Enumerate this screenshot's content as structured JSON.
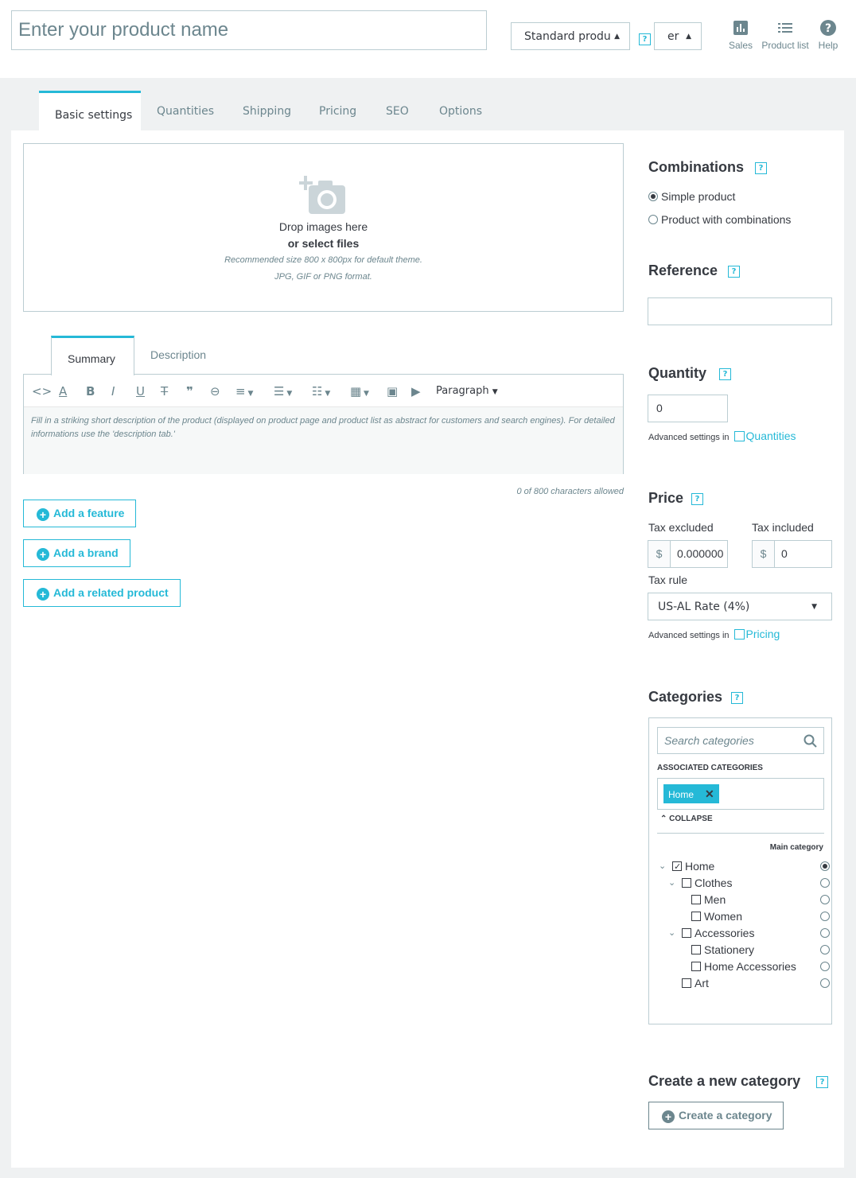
{
  "header": {
    "product_name_placeholder": "Enter your product name",
    "product_type": "Standard produ",
    "language": "er",
    "actions": [
      {
        "label": "Sales",
        "icon": "bar-chart-icon"
      },
      {
        "label": "Product list",
        "icon": "list-icon"
      },
      {
        "label": "Help",
        "icon": "help-circle-icon"
      }
    ]
  },
  "tabs": [
    "Basic settings",
    "Quantities",
    "Shipping",
    "Pricing",
    "SEO",
    "Options"
  ],
  "dropzone": {
    "line1": "Drop images here",
    "line2": "or select files",
    "line3": "Recommended size 800 x 800px for default theme.",
    "line4": "JPG, GIF or PNG format."
  },
  "editor": {
    "tabs": [
      "Summary",
      "Description"
    ],
    "format_label": "Paragraph",
    "placeholder": "Fill in a striking short description of the product (displayed on product page and product list as abstract for customers and search engines). For detailed informations use the 'description tab.'",
    "char_count": "0 of 800 characters allowed"
  },
  "buttons": {
    "add_feature": "Add a feature",
    "add_brand": "Add a brand",
    "add_related": "Add a related product"
  },
  "combinations": {
    "title": "Combinations",
    "help": "?",
    "options": [
      "Simple product",
      "Product with combinations"
    ],
    "selected": "Simple product"
  },
  "reference": {
    "title": "Reference",
    "value": ""
  },
  "quantity": {
    "title": "Quantity",
    "value": "0",
    "adv_label": "Advanced settings in",
    "adv_link": "Quantities"
  },
  "price": {
    "title": "Price",
    "tax_excluded_label": "Tax excluded",
    "tax_included_label": "Tax included",
    "currency": "$",
    "tax_excluded_value": "0.000000",
    "tax_included_value": "0",
    "tax_rule_label": "Tax rule",
    "tax_rule_value": "US-AL Rate (4%)",
    "adv_label": "Advanced settings in",
    "adv_link": "Pricing"
  },
  "categories": {
    "title": "Categories",
    "search_placeholder": "Search categories",
    "associated_label": "ASSOCIATED CATEGORIES",
    "tag": "Home",
    "collapse_label": "COLLAPSE",
    "main_category_label": "Main category",
    "tree": [
      "Home",
      "Clothes",
      "Men",
      "Women",
      "Accessories",
      "Stationery",
      "Home Accessories",
      "Art"
    ]
  },
  "new_category": {
    "title": "Create a new category",
    "button": "Create a category"
  },
  "colors": {
    "accent": "#25b9d7",
    "text": "#363a41",
    "muted": "#6c868e",
    "border": "#bbcdd2"
  }
}
